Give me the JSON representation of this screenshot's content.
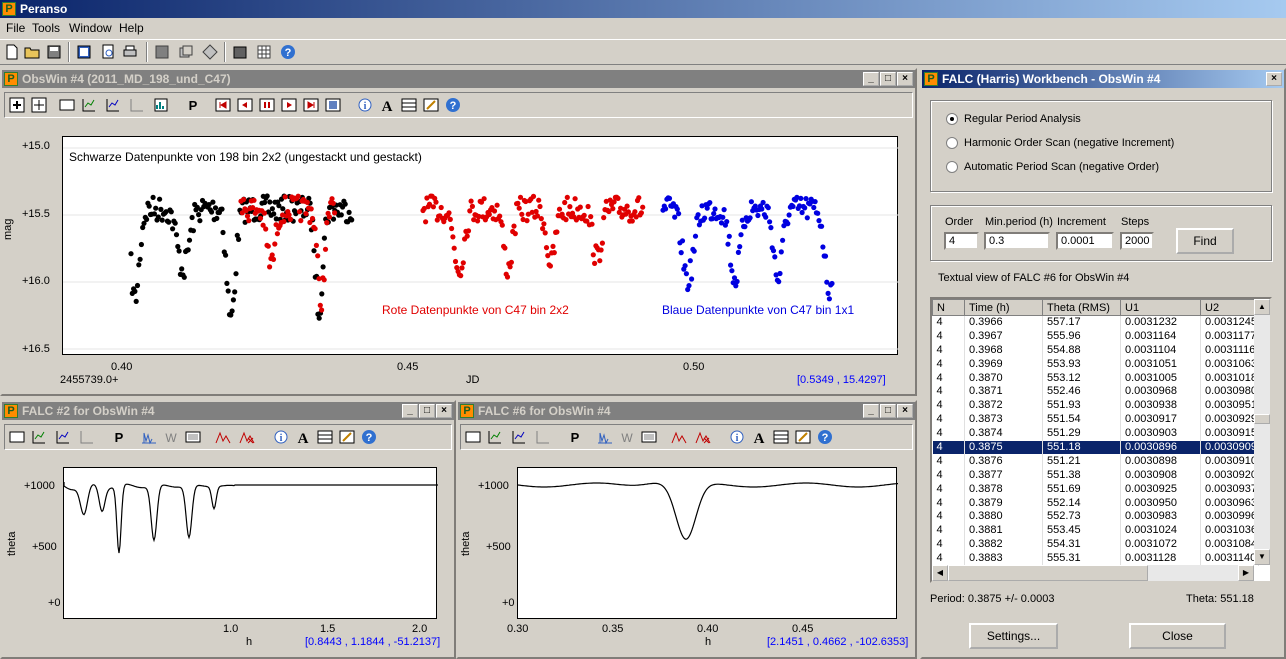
{
  "app": {
    "title": "Peranso",
    "logo": "P"
  },
  "menu": [
    "File",
    "Tools",
    "Window",
    "Help"
  ],
  "obswin": {
    "title": "ObsWin #4 (2011_MD_198_und_C47)",
    "annotation_black": "Schwarze Datenpunkte von 198 bin 2x2 (ungestackt und gestackt)",
    "annotation_red": "Rote Datenpunkte von C47 bin 2x2",
    "annotation_blue": "Blaue Datenpunkte von C47 bin 1x1",
    "y_ticks": [
      "+15.0",
      "+15.5",
      "+16.0",
      "+16.5"
    ],
    "x_ticks": [
      "0.40",
      "0.45",
      "0.50"
    ],
    "x_offset": "2455739.0+",
    "ylabel": "mag",
    "xlabel": "JD",
    "coord": "[0.5349 , 15.4297]"
  },
  "falc2": {
    "title": "FALC #2 for ObsWin #4",
    "y_ticks": [
      "+1000",
      "+500",
      "+0"
    ],
    "x_ticks": [
      "1.0",
      "1.5",
      "2.0"
    ],
    "ylabel": "theta",
    "xlabel": "h",
    "coord": "[0.8443 , 1.1844 , -51.2137]"
  },
  "falc6": {
    "title": "FALC #6 for ObsWin #4",
    "y_ticks": [
      "+1000",
      "+500",
      "+0"
    ],
    "x_ticks": [
      "0.30",
      "0.35",
      "0.40",
      "0.45"
    ],
    "ylabel": "theta",
    "xlabel": "h",
    "coord": "[2.1451 , 0.4662 , -102.6353]"
  },
  "workbench": {
    "title": "FALC (Harris) Workbench - ObsWin #4",
    "radio_options": [
      "Regular Period Analysis",
      "Harmonic Order Scan (negative Increment)",
      "Automatic Period Scan (negative Order)"
    ],
    "selected_radio": 0,
    "labels": {
      "order": "Order",
      "minperiod": "Min.period (h)",
      "increment": "Increment",
      "steps": "Steps"
    },
    "values": {
      "order": "4",
      "minperiod": "0.3",
      "increment": "0.0001",
      "steps": "2000"
    },
    "find_label": "Find",
    "textual_view": "Textual view of FALC #6 for ObsWin #4",
    "columns": [
      "N",
      "Time (h)",
      "Theta (RMS)",
      "U1",
      "U2"
    ],
    "rows": [
      [
        "4",
        "0.3966",
        "557.17",
        "0.0031232",
        "0.0031245"
      ],
      [
        "4",
        "0.3967",
        "555.96",
        "0.0031164",
        "0.0031177"
      ],
      [
        "4",
        "0.3968",
        "554.88",
        "0.0031104",
        "0.0031116"
      ],
      [
        "4",
        "0.3969",
        "553.93",
        "0.0031051",
        "0.0031063"
      ],
      [
        "4",
        "0.3870",
        "553.12",
        "0.0031005",
        "0.0031018"
      ],
      [
        "4",
        "0.3871",
        "552.46",
        "0.0030968",
        "0.0030980"
      ],
      [
        "4",
        "0.3872",
        "551.93",
        "0.0030938",
        "0.0030951"
      ],
      [
        "4",
        "0.3873",
        "551.54",
        "0.0030917",
        "0.0030929"
      ],
      [
        "4",
        "0.3874",
        "551.29",
        "0.0030903",
        "0.0030915"
      ],
      [
        "4",
        "0.3875",
        "551.18",
        "0.0030896",
        "0.0030909"
      ],
      [
        "4",
        "0.3876",
        "551.21",
        "0.0030898",
        "0.0030910"
      ],
      [
        "4",
        "0.3877",
        "551.38",
        "0.0030908",
        "0.0030920"
      ],
      [
        "4",
        "0.3878",
        "551.69",
        "0.0030925",
        "0.0030937"
      ],
      [
        "4",
        "0.3879",
        "552.14",
        "0.0030950",
        "0.0030963"
      ],
      [
        "4",
        "0.3880",
        "552.73",
        "0.0030983",
        "0.0030996"
      ],
      [
        "4",
        "0.3881",
        "553.45",
        "0.0031024",
        "0.0031036"
      ],
      [
        "4",
        "0.3882",
        "554.31",
        "0.0031072",
        "0.0031084"
      ],
      [
        "4",
        "0.3883",
        "555.31",
        "0.0031128",
        "0.0031140"
      ]
    ],
    "selected_row": 9,
    "period": "Period: 0.3875 +/- 0.0003",
    "theta": "Theta: 551.18",
    "settings_label": "Settings...",
    "close_label": "Close"
  }
}
